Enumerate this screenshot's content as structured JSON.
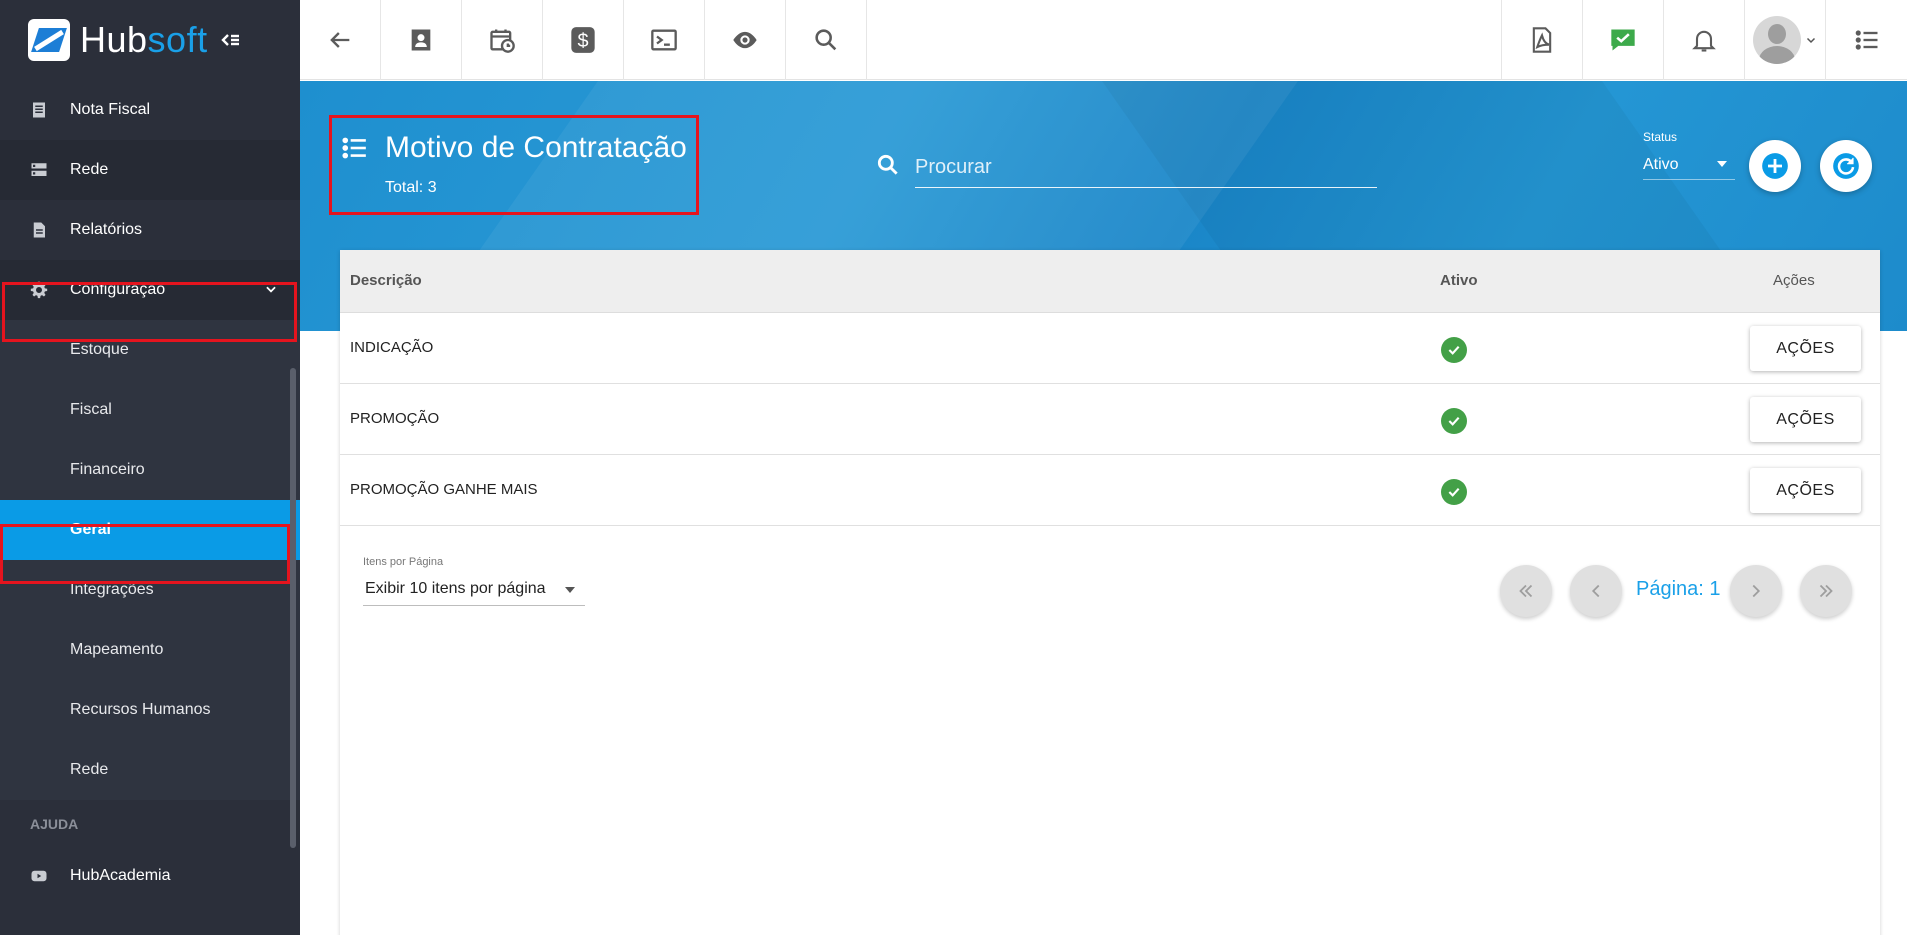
{
  "brand": {
    "name_part1": "Hub",
    "name_part2": "soft"
  },
  "sidebar": {
    "items": [
      {
        "label": "Nota Fiscal",
        "icon": "document-icon"
      },
      {
        "label": "Rede",
        "icon": "server-icon"
      },
      {
        "label": "Relatórios",
        "icon": "report-icon"
      },
      {
        "label": "Configuração",
        "icon": "gear-icon"
      }
    ],
    "subitems": [
      {
        "label": "Estoque"
      },
      {
        "label": "Fiscal"
      },
      {
        "label": "Financeiro"
      },
      {
        "label": "Geral"
      },
      {
        "label": "Integrações"
      },
      {
        "label": "Mapeamento"
      },
      {
        "label": "Recursos Humanos"
      },
      {
        "label": "Rede"
      }
    ],
    "section_help": "AJUDA",
    "help_items": [
      {
        "label": "HubAcademia",
        "icon": "youtube-icon"
      }
    ]
  },
  "topbar": {
    "icons": [
      "back-arrow-icon",
      "contact-card-icon",
      "calendar-clock-icon",
      "dollar-icon",
      "terminal-icon",
      "eye-icon",
      "search-icon"
    ],
    "right_icons": [
      "pdf-icon",
      "chat-check-icon",
      "bell-icon",
      "avatar",
      "list-icon"
    ]
  },
  "page": {
    "title": "Motivo de Contratação",
    "total": "Total: 3",
    "search_placeholder": "Procurar",
    "status_label": "Status",
    "status_value": "Ativo"
  },
  "table": {
    "headers": {
      "descricao": "Descrição",
      "ativo": "Ativo",
      "acoes": "Ações"
    },
    "rows": [
      {
        "descricao": "INDICAÇÃO",
        "ativo": true,
        "action_label": "AÇÕES"
      },
      {
        "descricao": "PROMOÇÃO",
        "ativo": true,
        "action_label": "AÇÕES"
      },
      {
        "descricao": "PROMOÇÃO GANHE MAIS",
        "ativo": true,
        "action_label": "AÇÕES"
      }
    ]
  },
  "pagination": {
    "items_label": "Itens por Página",
    "items_value": "Exibir 10 itens por página",
    "page_label": "Página: 1"
  },
  "colors": {
    "accent": "#0a9be6",
    "sidebar_bg": "#2b2f3a",
    "highlight": "#e5141e",
    "success": "#43a047"
  }
}
